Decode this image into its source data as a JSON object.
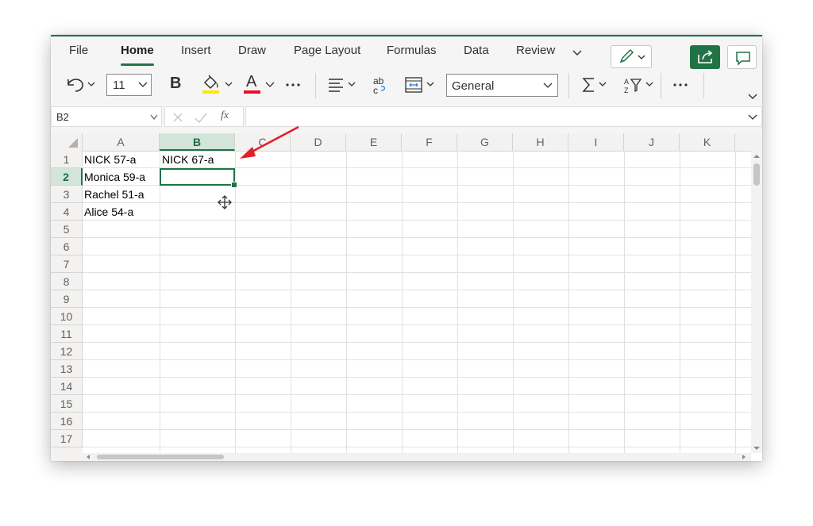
{
  "menu": {
    "tabs": [
      "File",
      "Home",
      "Insert",
      "Draw",
      "Page Layout",
      "Formulas",
      "Data",
      "Review"
    ],
    "active_tab": "Home"
  },
  "ribbon": {
    "font_size": "11",
    "number_format": "General",
    "bold_label": "B",
    "font_color_label": "A",
    "fill_color": "#ffe900",
    "font_color": "#e81123"
  },
  "formula_bar": {
    "name_box": "B2",
    "fx_label": "fx",
    "value": ""
  },
  "grid": {
    "columns": [
      "A",
      "B",
      "C",
      "D",
      "E",
      "F",
      "G",
      "H",
      "I",
      "J",
      "K"
    ],
    "active_column": "B",
    "rows": [
      "1",
      "2",
      "3",
      "4",
      "5",
      "6",
      "7",
      "8",
      "9",
      "10",
      "11",
      "12",
      "13",
      "14",
      "15",
      "16",
      "17"
    ],
    "active_row": "2",
    "cells": {
      "A1": "NICK 57-a",
      "B1": "NICK 67-a",
      "A2": "Monica 59-a",
      "A3": "Rachel 51-a",
      "A4": "Alice 54-a"
    },
    "selected_cell": "B2"
  },
  "colors": {
    "accent": "#217346",
    "annotation_arrow": "#e0202a"
  }
}
